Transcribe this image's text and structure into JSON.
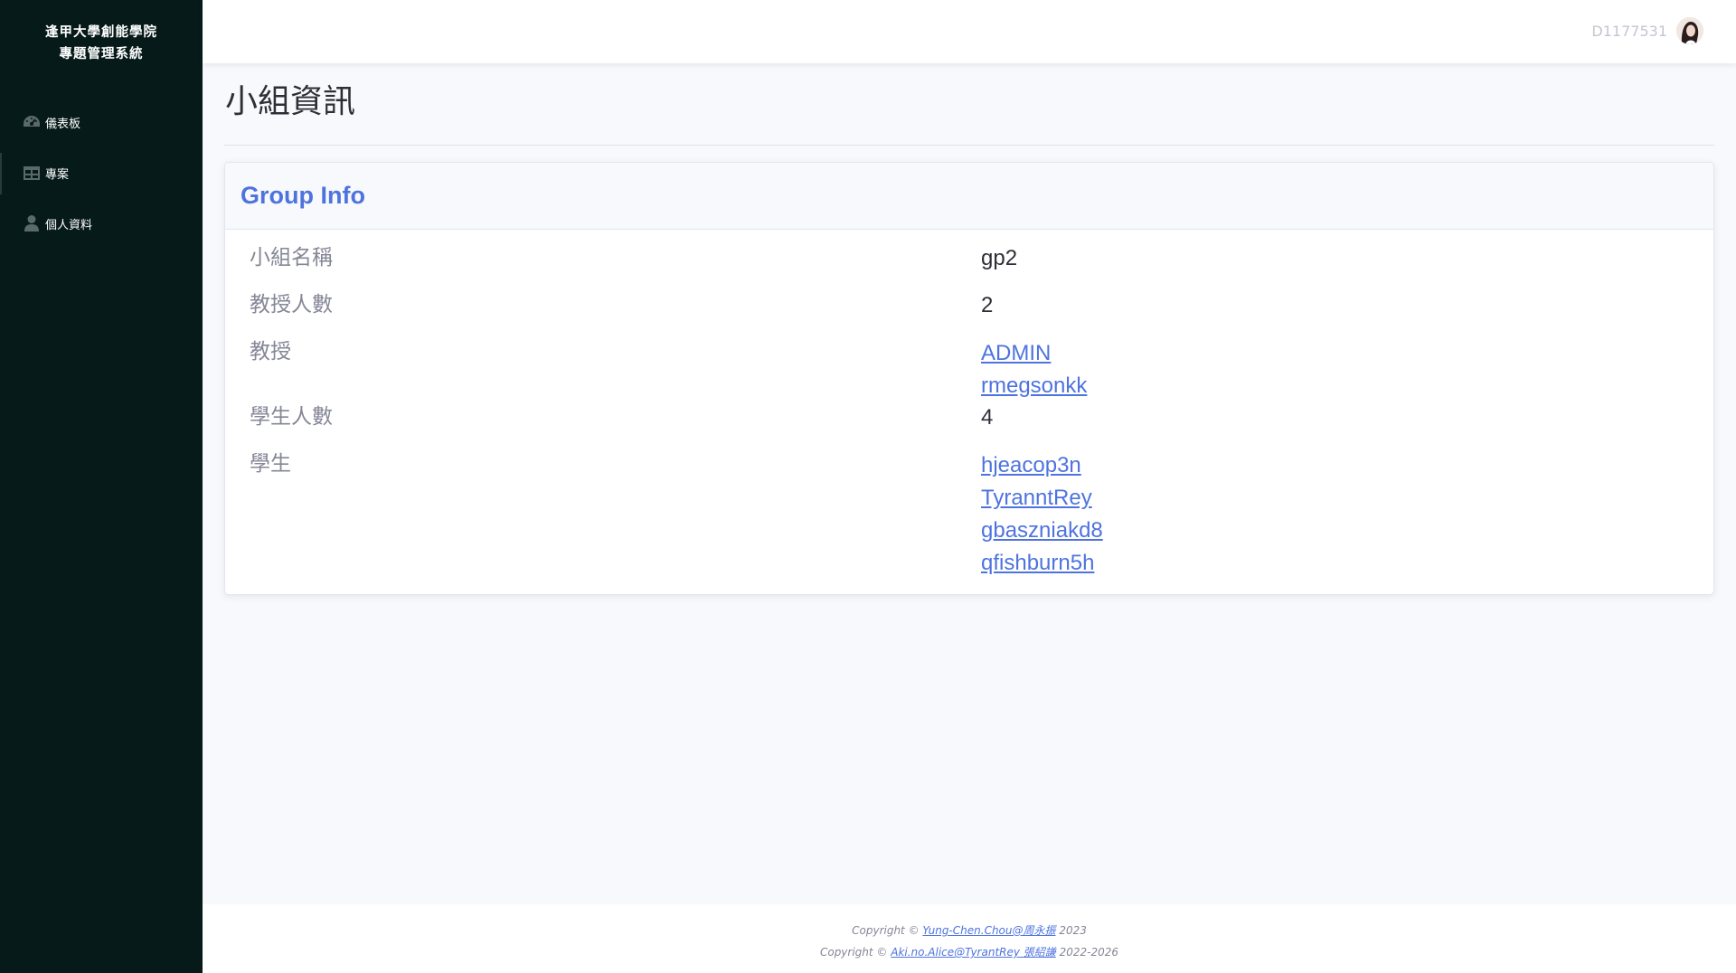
{
  "sidebar": {
    "brand_line1": "逢甲大學創能學院",
    "brand_line2": "專題管理系統",
    "items": [
      {
        "label": "儀表板",
        "icon": "tachometer-icon"
      },
      {
        "label": "專案",
        "icon": "table-icon"
      },
      {
        "label": "個人資料",
        "icon": "user-icon"
      }
    ]
  },
  "topbar": {
    "username": "D1177531"
  },
  "page": {
    "title": "小組資訊"
  },
  "card": {
    "title": "Group Info",
    "fields": {
      "group_name_label": "小組名稱",
      "group_name_value": "gp2",
      "professor_count_label": "教授人數",
      "professor_count_value": "2",
      "professors_label": "教授",
      "professors": [
        "ADMIN",
        "rmegsonkk"
      ],
      "student_count_label": "學生人數",
      "student_count_value": "4",
      "students_label": "學生",
      "students": [
        "hjeacop3n",
        "TyranntRey",
        "gbaszniakd8",
        "qfishburn5h"
      ]
    }
  },
  "footer": {
    "line1_prefix": "Copyright © ",
    "line1_link": "Yung-Chen.Chou@周永振",
    "line1_suffix": " 2023",
    "line2_prefix": "Copyright © ",
    "line2_link": "Aki.no.Alice@TyrantRey 張紹謙",
    "line2_suffix": " 2022-2026"
  }
}
